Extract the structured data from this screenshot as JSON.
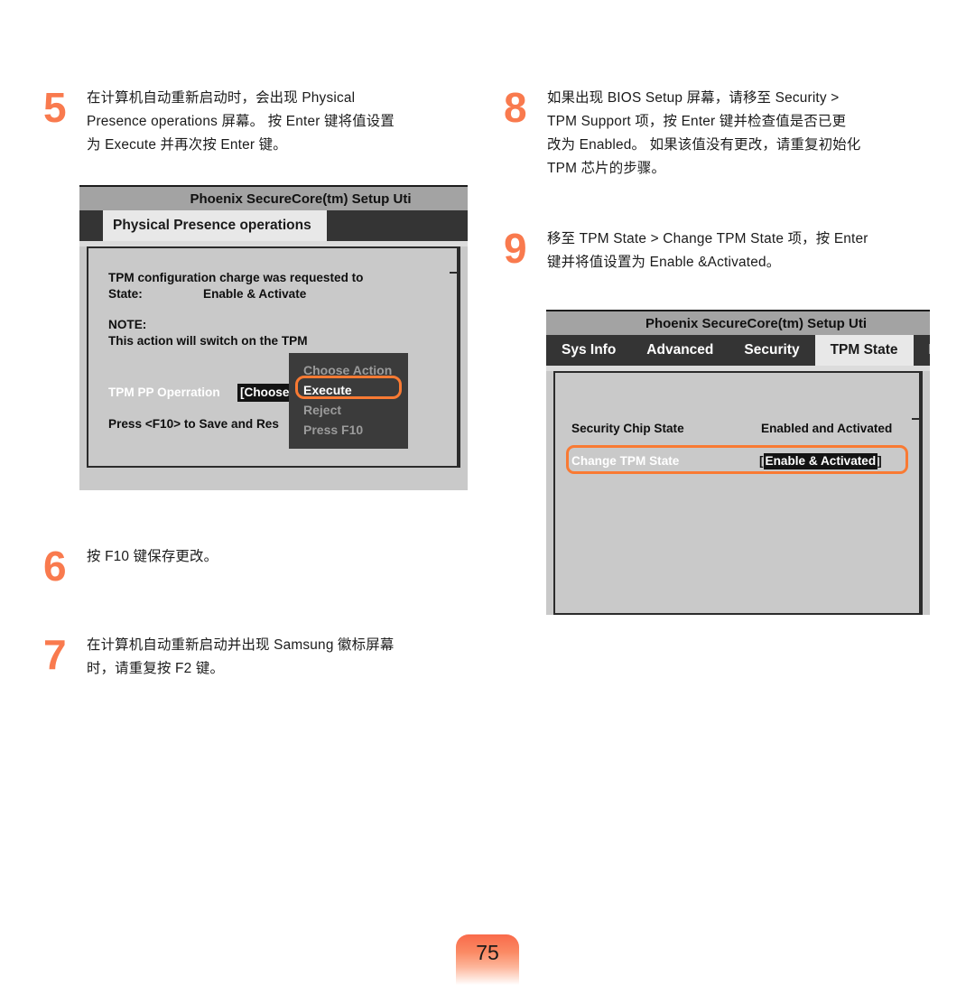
{
  "page": {
    "number": "75",
    "accent_color": "#f97a4e",
    "text_color": "#1b1b1b"
  },
  "steps": [
    {
      "number": "5",
      "lines": [
        "在计算机自动重新启动时，会出现 Physical",
        "Presence operations 屏幕。 按 Enter 键将值设置",
        "为 Execute 并再次按 Enter 键。"
      ]
    },
    {
      "number": "6",
      "lines": [
        "按 F10 键保存更改。"
      ]
    },
    {
      "number": "7",
      "lines": [
        "在计算机自动重新启动并出现 Samsung 徽标屏幕",
        "时，请重复按 F2 键。"
      ]
    },
    {
      "number": "8",
      "lines": [
        "如果出现 BIOS Setup 屏幕，请移至 Security >",
        "TPM Support 项，按 Enter 键并检查值是否已更",
        "改为 Enabled。 如果该值没有更改，请重复初始化",
        "TPM 芯片的步骤。"
      ]
    },
    {
      "number": "9",
      "lines": [
        "移至 TPM State > Change TPM State 项，按 Enter",
        "键并将值设置为 Enable &Activated。"
      ]
    }
  ],
  "bios_physical_presence": {
    "title": "Phoenix SecureCore(tm) Setup Uti",
    "active_tab": "Physical Presence operations",
    "body": {
      "line1": "TPM configuration charge was requested to",
      "line2_label": "State:",
      "line2_value": "Enable & Activate",
      "note_label": "NOTE:",
      "note_text": "This action will switch on the TPM",
      "operation_label": "TPM PP Operration",
      "operation_value": "[Choose A",
      "footer": "Press <F10> to Save and Res"
    },
    "dropdown": {
      "items": [
        {
          "label": "Choose Action",
          "selected": false
        },
        {
          "label": "Execute",
          "selected": true
        },
        {
          "label": "Reject",
          "selected": false
        },
        {
          "label": "Press F10",
          "selected": false
        }
      ],
      "highlight_color": "#f97a33"
    }
  },
  "bios_tpm_state": {
    "title": "Phoenix SecureCore(tm) Setup Uti",
    "tabs": [
      {
        "label": "Sys Info",
        "active": false
      },
      {
        "label": "Advanced",
        "active": false
      },
      {
        "label": "Security",
        "active": false
      },
      {
        "label": "TPM State",
        "active": true
      },
      {
        "label": "B",
        "active": false
      }
    ],
    "rows": [
      {
        "label": "Security Chip State",
        "value": "Enabled and Activated",
        "highlighted": false,
        "boxed_value": false
      },
      {
        "label": "Change TPM State",
        "value": "Enable & Activated",
        "highlighted": true,
        "boxed_value": true
      }
    ],
    "highlight_color": "#f97a33"
  }
}
